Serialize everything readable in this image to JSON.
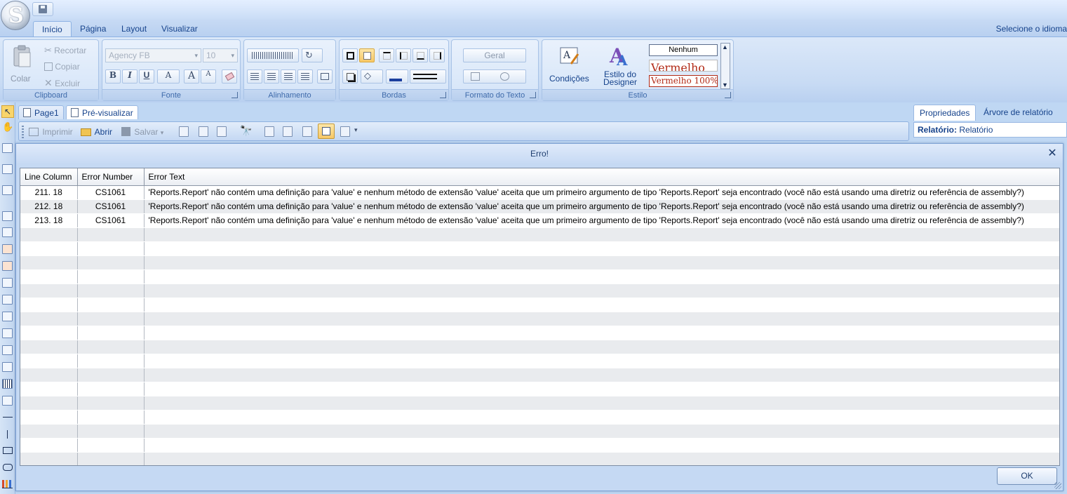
{
  "quick_access": {
    "orb_letter": "S"
  },
  "ribbon_tabs": [
    "Início",
    "Página",
    "Layout",
    "Visualizar"
  ],
  "language_selector": "Selecione o idioma",
  "clipboard": {
    "paste_label": "Colar",
    "cut_label": "Recortar",
    "copy_label": "Copiar",
    "delete_label": "Excluir",
    "group_label": "Clipboard"
  },
  "font": {
    "family": "Agency FB",
    "size": "10",
    "bold": "B",
    "italic": "I",
    "underline": "U",
    "color": "A",
    "grow": "A",
    "shrink": "A",
    "group_label": "Fonte"
  },
  "alignment": {
    "group_label": "Alinhamento"
  },
  "borders": {
    "group_label": "Bordas"
  },
  "text_format": {
    "value": "Geral",
    "group_label": "Formato do Texto"
  },
  "style": {
    "conditions_label": "Condições",
    "designer_style_label": "Estilo do Designer",
    "style_items": [
      "Nenhum",
      "Vermelho",
      "Vermelho 100%"
    ],
    "group_label": "Estilo",
    "accent_red": "#b22a16"
  },
  "doc_tabs": [
    "Page1",
    "Pré-visualizar"
  ],
  "preview_toolbar": {
    "print_label": "Imprimir",
    "open_label": "Abrir",
    "save_label": "Salvar"
  },
  "props_panel": {
    "tabs": [
      "Propriedades",
      "Árvore de relatório"
    ],
    "header_key": "Relatório:",
    "header_value": "Relatório"
  },
  "dialog": {
    "title": "Erro!",
    "close_glyph": "✕",
    "ok_label": "OK",
    "columns": [
      "Line Column",
      "Error Number",
      "Error Text"
    ],
    "rows": [
      {
        "line": "211. 18",
        "number": "CS1061",
        "text": "'Reports.Report' não contém uma definição para 'value' e nenhum método de extensão 'value' aceita que um primeiro argumento de tipo 'Reports.Report' seja encontrado (você não está usando uma diretriz ou referência de assembly?)"
      },
      {
        "line": "212. 18",
        "number": "CS1061",
        "text": "'Reports.Report' não contém uma definição para 'value' e nenhum método de extensão 'value' aceita que um primeiro argumento de tipo 'Reports.Report' seja encontrado (você não está usando uma diretriz ou referência de assembly?)"
      },
      {
        "line": "213. 18",
        "number": "CS1061",
        "text": "'Reports.Report' não contém uma definição para 'value' e nenhum método de extensão 'value' aceita que um primeiro argumento de tipo 'Reports.Report' seja encontrado (você não está usando uma diretriz ou referência de assembly?)"
      }
    ]
  },
  "colors": {
    "ribbon_blue": "#c8dbf4",
    "text_blue": "#15428b",
    "grid_alt_row": "#e9ebee"
  }
}
